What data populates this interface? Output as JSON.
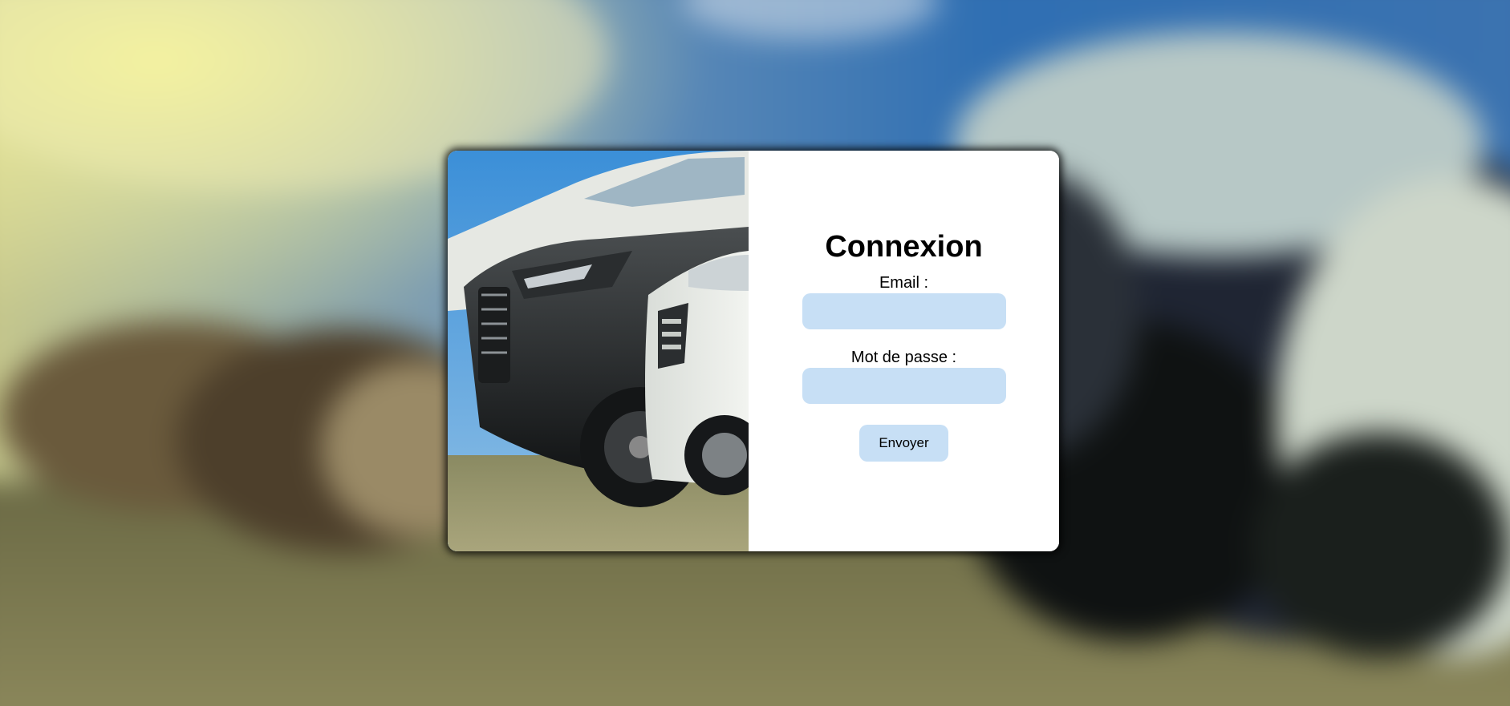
{
  "login": {
    "title": "Connexion",
    "email_label": "Email :",
    "email_value": "",
    "password_label": "Mot de passe :",
    "password_value": "",
    "submit_label": "Envoyer"
  },
  "colors": {
    "input_background": "#c7dff5",
    "button_background": "#c7dff5",
    "card_background": "#ffffff"
  }
}
